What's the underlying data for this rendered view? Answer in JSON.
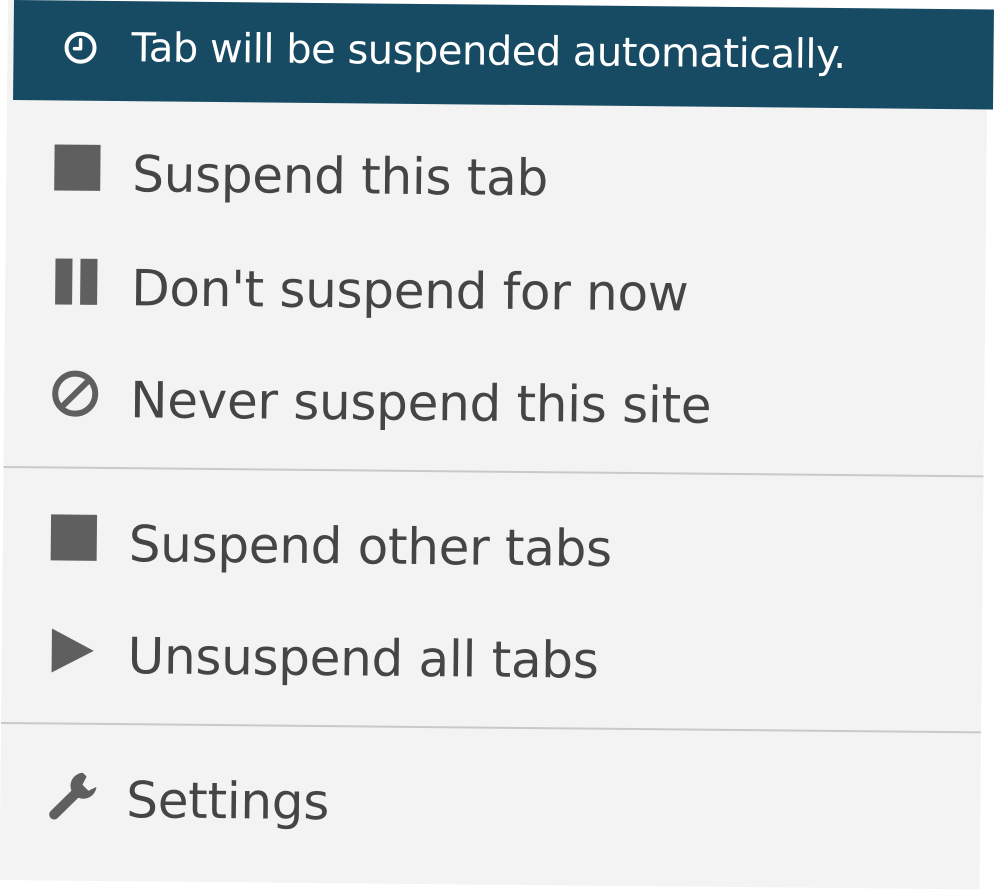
{
  "status": {
    "text": "Tab will be suspended automatically.",
    "icon": "clock-icon",
    "background_color": "#174a63"
  },
  "menu": {
    "group_current": [
      {
        "label": "Suspend this tab",
        "icon": "stop-square-icon"
      },
      {
        "label": "Don't suspend for now",
        "icon": "pause-icon"
      },
      {
        "label": "Never suspend this site",
        "icon": "prohibited-icon"
      }
    ],
    "group_all": [
      {
        "label": "Suspend other tabs",
        "icon": "stop-square-icon"
      },
      {
        "label": "Unsuspend all tabs",
        "icon": "play-icon"
      }
    ],
    "group_settings": [
      {
        "label": "Settings",
        "icon": "wrench-icon"
      }
    ]
  },
  "colors": {
    "panel_background": "#f3f3f3",
    "text": "#454545",
    "icon": "#5f5f5f",
    "divider": "#c9c9c9"
  }
}
